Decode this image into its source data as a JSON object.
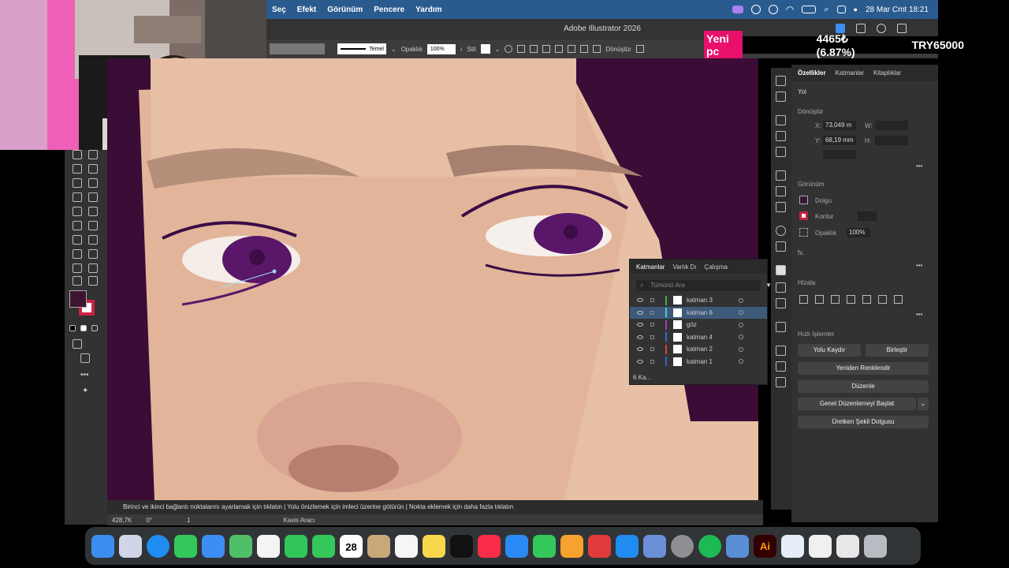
{
  "menubar": {
    "items": [
      "Seç",
      "Efekt",
      "Görünüm",
      "Pencere",
      "Yardım"
    ],
    "datetime": "28 Mar Cmt  18:21"
  },
  "titlebar": {
    "title": "Adobe Illustrator 2026"
  },
  "controlbar": {
    "stroke_profile": "Temel",
    "opacity_label": "Opaklık",
    "opacity_value": "100%",
    "style_label": "Stil",
    "transform_label": "Dönüştür"
  },
  "ticker": {
    "tag": "Yeni pc",
    "value": "4465₺ (6.87%)",
    "target": "TRY65000"
  },
  "props": {
    "tabs": [
      "Özellikler",
      "Katmanlar",
      "Kitaplıklar"
    ],
    "section_path": "Yol",
    "section_transform": "Dönüştür",
    "x_label": "X:",
    "x_value": "73,049 m",
    "y_label": "Y:",
    "y_value": "68,19 mm",
    "w_label": "W:",
    "h_label": "H:",
    "section_appearance": "Görünüm",
    "fill_label": "Dolgu",
    "stroke_label": "Kontur",
    "opacity_label": "Opaklık",
    "opacity_value": "100%",
    "fx_label": "fx.",
    "section_align": "Hizala",
    "section_quick": "Hızlı İşlemler",
    "btn_offset": "Yolu Kaydır",
    "btn_unite": "Birleştir",
    "btn_recolor": "Yeniden Renklendir",
    "btn_arrange": "Düzenle",
    "btn_gen_edit": "Genel Düzenlemeyi Başlat",
    "btn_gen_fill": "Üretken Şekil Dolgusu",
    "colors": {
      "fill": "#3c1630",
      "stroke": "#c02040"
    }
  },
  "layers": {
    "tabs": [
      "Katmanlar",
      "Varlık Dı",
      "Çalışma"
    ],
    "search_placeholder": "Tümünü Ara",
    "rows": [
      {
        "name": "katman 3",
        "color": "#3cb44b"
      },
      {
        "name": "katman 6",
        "color": "#4ec9e0"
      },
      {
        "name": "göz",
        "color": "#9b3fc4"
      },
      {
        "name": "katman 4",
        "color": "#2f6fd0"
      },
      {
        "name": "katman 2",
        "color": "#e03c3c"
      },
      {
        "name": "katman 1",
        "color": "#3a5fcf"
      }
    ],
    "footer_count": "6 Ka..."
  },
  "status": {
    "hint": "Birinci ve ikinci bağlantı noktalarını ayarlamak için tıklatın  |  Yolu önizlemek için imleci üzerine götürün  |  Nokta eklemek için daha fazla tıklatın",
    "zoom": "428,7K",
    "angle": "0°",
    "artboard": "1",
    "tool": "Kavis Aracı"
  },
  "dock": {
    "calendar_day": "28",
    "icons": [
      {
        "name": "finder",
        "color": "#3b8ef0"
      },
      {
        "name": "launchpad",
        "color": "#d0d6e8"
      },
      {
        "name": "safari",
        "color": "#1e8cf0"
      },
      {
        "name": "messages",
        "color": "#34c759"
      },
      {
        "name": "mail",
        "color": "#3c8ef5"
      },
      {
        "name": "maps",
        "color": "#4fbf6a"
      },
      {
        "name": "photos",
        "color": "#f4f4f4"
      },
      {
        "name": "facetime",
        "color": "#30c659"
      },
      {
        "name": "phone",
        "color": "#34c759"
      },
      {
        "name": "calendar",
        "color": "#ffffff"
      },
      {
        "name": "contacts",
        "color": "#c8a878"
      },
      {
        "name": "reminders",
        "color": "#f6f6f6"
      },
      {
        "name": "notes",
        "color": "#f7d84a"
      },
      {
        "name": "tv",
        "color": "#111111"
      },
      {
        "name": "music",
        "color": "#fa2d48"
      },
      {
        "name": "keynote",
        "color": "#2a8af5"
      },
      {
        "name": "numbers",
        "color": "#34c759"
      },
      {
        "name": "pages",
        "color": "#f7a22e"
      },
      {
        "name": "rocket",
        "color": "#e23a3a"
      },
      {
        "name": "appstore",
        "color": "#1e8cf0"
      },
      {
        "name": "preview",
        "color": "#6b8fd6"
      },
      {
        "name": "settings",
        "color": "#8e8e93"
      },
      {
        "name": "spotify",
        "color": "#1db954"
      },
      {
        "name": "finder2",
        "color": "#5a8fd8"
      },
      {
        "name": "illustrator",
        "color": "#330000"
      },
      {
        "name": "vpn",
        "color": "#e8eef8"
      },
      {
        "name": "document",
        "color": "#f0f0f0"
      },
      {
        "name": "screen",
        "color": "#e8e8e8"
      },
      {
        "name": "trash",
        "color": "#b8bcc2"
      }
    ]
  }
}
